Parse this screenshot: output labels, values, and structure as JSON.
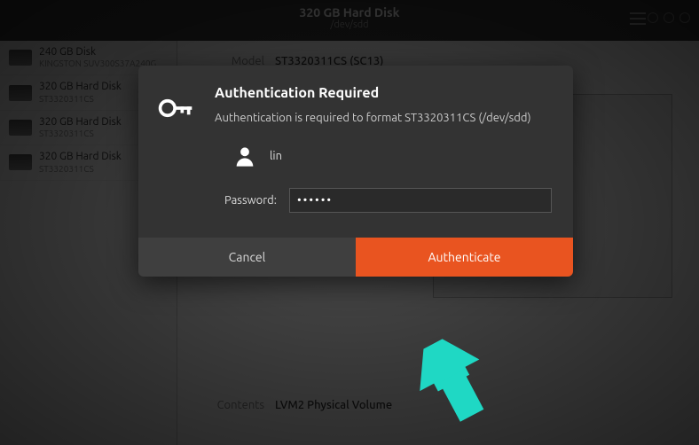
{
  "header": {
    "title": "320 GB Hard Disk",
    "subtitle": "/dev/sdd"
  },
  "sidebar": {
    "items": [
      {
        "title": "240 GB Disk",
        "sub": "KINGSTON SUV300S37A240G"
      },
      {
        "title": "320 GB Hard Disk",
        "sub": "ST3320311CS"
      },
      {
        "title": "320 GB Hard Disk",
        "sub": "ST3320311CS"
      },
      {
        "title": "320 GB Hard Disk",
        "sub": "ST3320311CS"
      }
    ]
  },
  "main": {
    "model_label": "Model",
    "model_value": "ST3320311CS (SC13)",
    "contents_label": "Contents",
    "contents_value": "LVM2 Physical Volume"
  },
  "dialog": {
    "title": "Authentication Required",
    "message": "Authentication is required to format ST3320311CS (/dev/sdd)",
    "user": "lin",
    "password_label": "Password:",
    "password_value": "••••••",
    "cancel": "Cancel",
    "authenticate": "Authenticate"
  },
  "colors": {
    "accent": "#e95420",
    "cursor": "#1fd8c4"
  }
}
